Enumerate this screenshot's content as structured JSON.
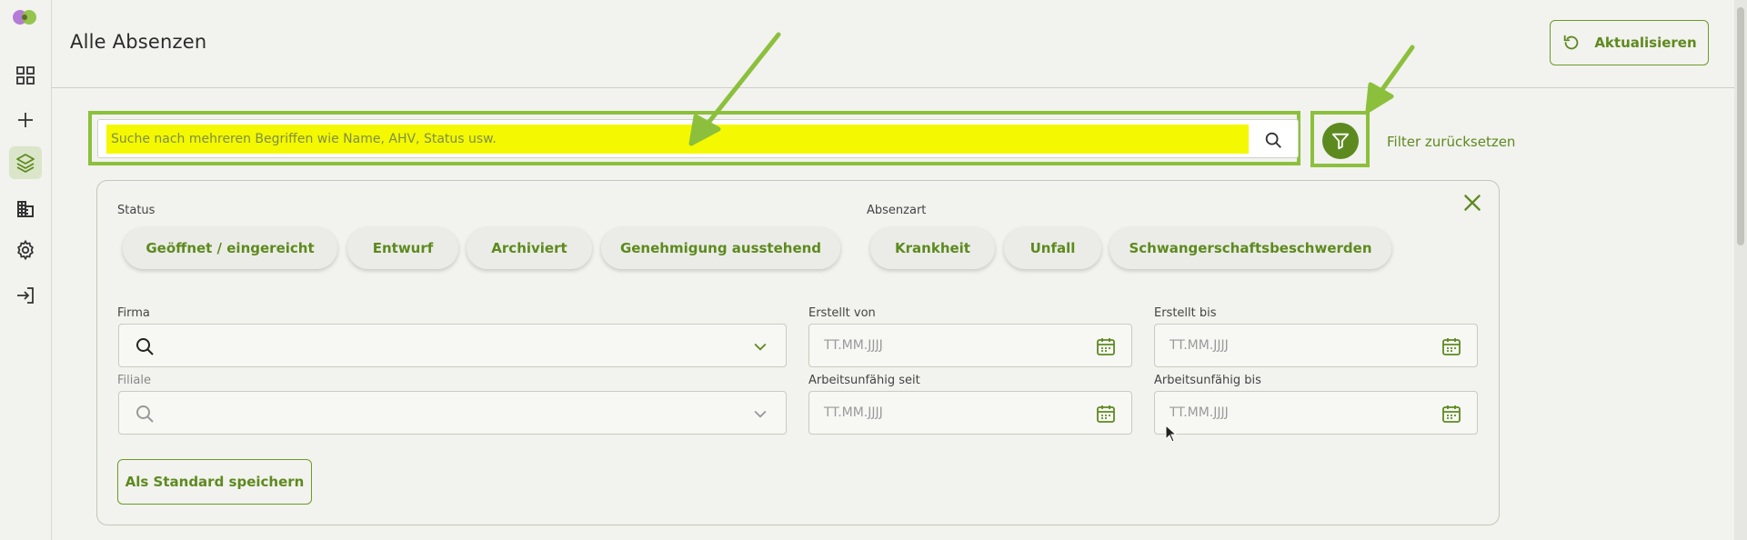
{
  "header": {
    "title": "Alle Absenzen",
    "refresh_label": "Aktualisieren"
  },
  "sidebar": {
    "items": [
      {
        "icon": "dashboard-icon"
      },
      {
        "icon": "plus-icon"
      },
      {
        "icon": "layers-icon",
        "active": true
      },
      {
        "icon": "building-icon"
      },
      {
        "icon": "gear-icon"
      },
      {
        "icon": "logout-icon"
      }
    ]
  },
  "search": {
    "placeholder": "Suche nach mehreren Begriffen wie Name, AHV, Status usw."
  },
  "filter": {
    "reset_label": "Filter zurücksetzen"
  },
  "panel": {
    "status_label": "Status",
    "status_chips": [
      "Geöffnet / eingereicht",
      "Entwurf",
      "Archiviert",
      "Genehmigung ausstehend"
    ],
    "absenzart_label": "Absenzart",
    "absenzart_chips": [
      "Krankheit",
      "Unfall",
      "Schwangerschaftsbeschwerden"
    ],
    "firma_label": "Firma",
    "filiale_label": "Filiale",
    "erstellt_von_label": "Erstellt von",
    "erstellt_bis_label": "Erstellt bis",
    "au_seit_label": "Arbeitsunfähig seit",
    "au_bis_label": "Arbeitsunfähig bis",
    "date_placeholder": "TT.MM.JJJJ",
    "save_label": "Als Standard speichern"
  },
  "colors": {
    "accent": "#5d8a1f",
    "highlight": "#f4f800",
    "annotation": "#8cc03c"
  }
}
